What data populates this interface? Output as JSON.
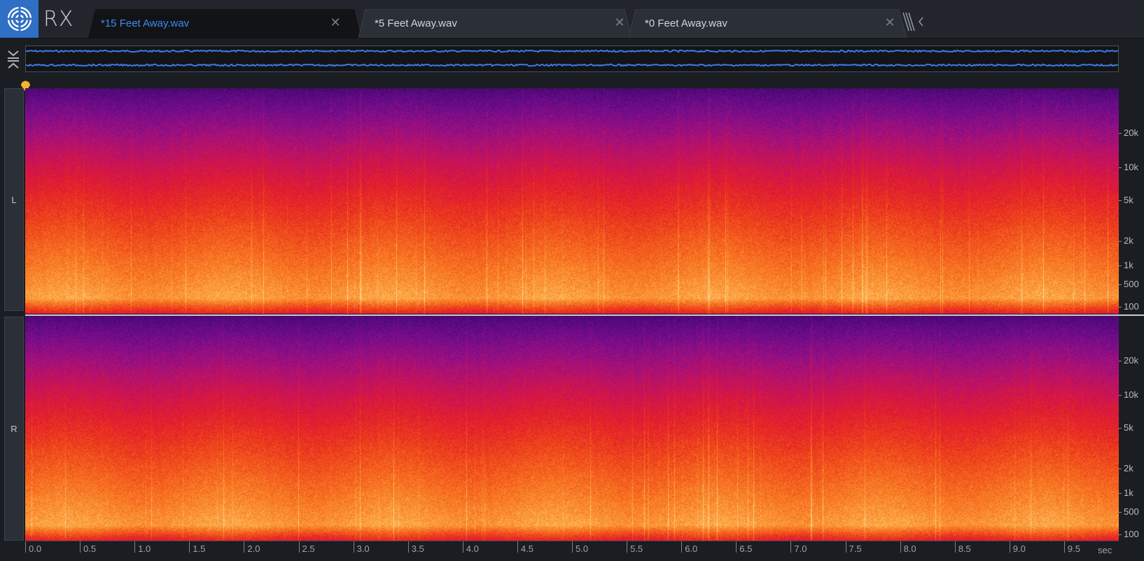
{
  "app": {
    "name": "RX"
  },
  "tabs": [
    {
      "label": "*15 Feet Away.wav",
      "active": true
    },
    {
      "label": "*5 Feet Away.wav",
      "active": false
    },
    {
      "label": "*0 Feet Away.wav",
      "active": false
    }
  ],
  "channels": [
    {
      "label": "L"
    },
    {
      "label": "R"
    }
  ],
  "freq_axis": [
    "20k",
    "10k",
    "5k",
    "2k",
    "1k",
    "500",
    "100"
  ],
  "time_axis": [
    "0.0",
    "0.5",
    "1.0",
    "1.5",
    "2.0",
    "2.5",
    "3.0",
    "3.5",
    "4.0",
    "4.5",
    "5.0",
    "5.5",
    "6.0",
    "6.5",
    "7.0",
    "7.5",
    "8.0",
    "8.5",
    "9.0",
    "9.5"
  ],
  "time_unit": "sec",
  "colors": {
    "accent": "#3d8bef",
    "logo_bg": "#2f6fc4",
    "waveform": "#3b7be0"
  }
}
